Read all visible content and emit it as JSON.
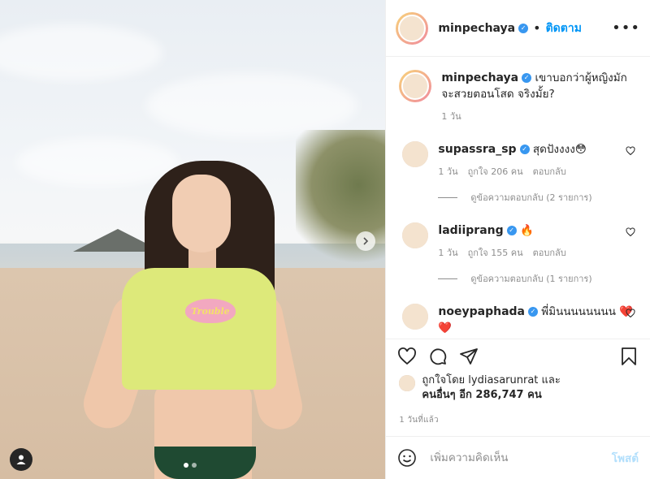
{
  "photo": {
    "shirt_text": "Trouble",
    "icons": {
      "next": "chevron-right-icon",
      "user_tag": "user-icon"
    }
  },
  "header": {
    "username": "minpechaya",
    "separator": "•",
    "follow_label": "ติดตาม",
    "more_label": "•••"
  },
  "caption": {
    "username": "minpechaya",
    "text": "เขาบอกว่าผู้หญิงมักจะสวยตอนโสด จริงมั้ย?",
    "time": "1 วัน"
  },
  "comments": [
    {
      "username": "supassra_sp",
      "text": "สุดปังงงง😳",
      "time": "1 วัน",
      "likes": "ถูกใจ 206 คน",
      "reply_label": "ตอบกลับ",
      "view_replies": "ดูข้อความตอบกลับ (2 รายการ)"
    },
    {
      "username": "ladiiprang",
      "text": "🔥",
      "time": "1 วัน",
      "likes": "ถูกใจ 155 คน",
      "reply_label": "ตอบกลับ",
      "view_replies": "ดูข้อความตอบกลับ (1 รายการ)"
    },
    {
      "username": "noeypaphada",
      "text": "พี่มินนนนนนนน ❤️❤️"
    }
  ],
  "likes": {
    "line1": "ถูกใจโดย lydiasarunrat และ",
    "line2": "คนอื่นๆ อีก 286,747 คน"
  },
  "timestamp": "1 วันที่แล้ว",
  "add_comment": {
    "placeholder": "เพิ่มความคิดเห็น",
    "post_label": "โพสต์"
  },
  "colors": {
    "accent": "#0095f6",
    "verified": "#3897f0",
    "heart": "#ed4956"
  }
}
